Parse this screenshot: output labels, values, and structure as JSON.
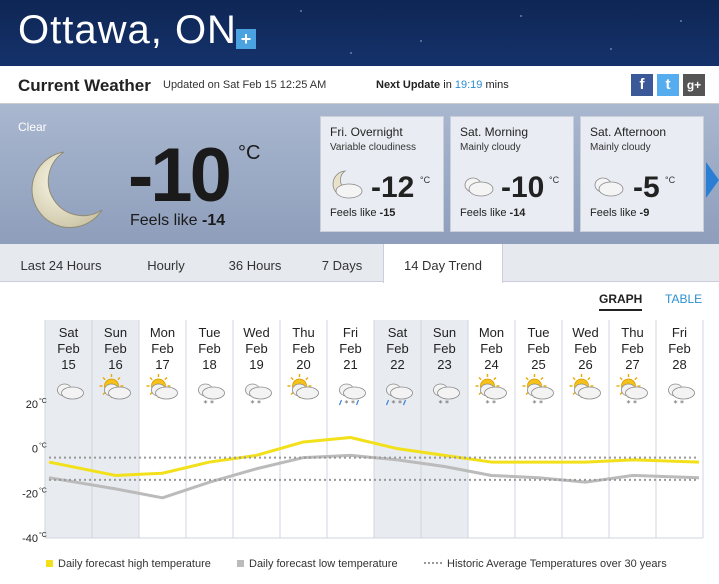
{
  "header": {
    "city": "Ottawa, ON",
    "add_label": "+"
  },
  "current_bar": {
    "title": "Current Weather",
    "updated": "Updated on Sat Feb 15 12:25 AM",
    "next_update_prefix": "Next Update",
    "next_update_in": "in",
    "next_update_time": "19:19",
    "next_update_suffix": "mins",
    "social": [
      {
        "label": "f",
        "color": "#3b5998"
      },
      {
        "label": "t",
        "color": "#55acee"
      },
      {
        "label": "g+",
        "color": "#555555"
      }
    ]
  },
  "current": {
    "condition": "Clear",
    "temp": "-10",
    "unit": "°C",
    "feels_label": "Feels like",
    "feels_value": "-14"
  },
  "forecasts": [
    {
      "period": "Fri. Overnight",
      "desc": "Variable cloudiness",
      "temp": "-12",
      "unit": "°C",
      "feels_label": "Feels like",
      "feels": "-15",
      "icon": "moon-cloud-icon"
    },
    {
      "period": "Sat. Morning",
      "desc": "Mainly cloudy",
      "temp": "-10",
      "unit": "°C",
      "feels_label": "Feels like",
      "feels": "-14",
      "icon": "cloud-icon"
    },
    {
      "period": "Sat. Afternoon",
      "desc": "Mainly cloudy",
      "temp": "-5",
      "unit": "°C",
      "feels_label": "Feels like",
      "feels": "-9",
      "icon": "cloud-icon"
    }
  ],
  "tabs": [
    "Last 24 Hours",
    "Hourly",
    "36 Hours",
    "7 Days",
    "14 Day Trend"
  ],
  "active_tab": "14 Day Trend",
  "view_toggle": {
    "graph": "GRAPH",
    "table": "TABLE"
  },
  "days": [
    {
      "dow": "Sat",
      "mon": "Feb",
      "day": "15",
      "icon": "cloud-icon",
      "weekend": true
    },
    {
      "dow": "Sun",
      "mon": "Feb",
      "day": "16",
      "icon": "sun-cloud-icon",
      "weekend": true
    },
    {
      "dow": "Mon",
      "mon": "Feb",
      "day": "17",
      "icon": "sun-cloud-icon",
      "weekend": false
    },
    {
      "dow": "Tue",
      "mon": "Feb",
      "day": "18",
      "icon": "snow-cloud-icon",
      "weekend": false
    },
    {
      "dow": "Wed",
      "mon": "Feb",
      "day": "19",
      "icon": "snow-cloud-icon",
      "weekend": false
    },
    {
      "dow": "Thu",
      "mon": "Feb",
      "day": "20",
      "icon": "sun-cloud-icon",
      "weekend": false
    },
    {
      "dow": "Fri",
      "mon": "Feb",
      "day": "21",
      "icon": "snow-rain-icon",
      "weekend": false
    },
    {
      "dow": "Sat",
      "mon": "Feb",
      "day": "22",
      "icon": "snow-rain-icon",
      "weekend": true
    },
    {
      "dow": "Sun",
      "mon": "Feb",
      "day": "23",
      "icon": "snow-cloud-icon",
      "weekend": true
    },
    {
      "dow": "Mon",
      "mon": "Feb",
      "day": "24",
      "icon": "sun-snow-icon",
      "weekend": false
    },
    {
      "dow": "Tue",
      "mon": "Feb",
      "day": "25",
      "icon": "sun-snow-icon",
      "weekend": false
    },
    {
      "dow": "Wed",
      "mon": "Feb",
      "day": "26",
      "icon": "sun-cloud-icon",
      "weekend": false
    },
    {
      "dow": "Thu",
      "mon": "Feb",
      "day": "27",
      "icon": "sun-snow-icon",
      "weekend": false
    },
    {
      "dow": "Fri",
      "mon": "Feb",
      "day": "28",
      "icon": "snow-cloud-icon",
      "weekend": false
    }
  ],
  "chart_data": {
    "type": "line",
    "x": [
      "Feb 15",
      "Feb 16",
      "Feb 17",
      "Feb 18",
      "Feb 19",
      "Feb 20",
      "Feb 21",
      "Feb 22",
      "Feb 23",
      "Feb 24",
      "Feb 25",
      "Feb 26",
      "Feb 27",
      "Feb 28"
    ],
    "ylim": [
      -40,
      20
    ],
    "yticks": [
      {
        "value": 20,
        "label": "20"
      },
      {
        "value": 0,
        "label": "0"
      },
      {
        "value": -20,
        "label": "-20"
      },
      {
        "value": -40,
        "label": "-40"
      }
    ],
    "tick_unit": "°C",
    "series": [
      {
        "name": "Daily forecast high temperature",
        "color": "#f2e01a",
        "values": [
          -6,
          -12,
          -11,
          -6,
          -3,
          3,
          5,
          0,
          -3,
          -6,
          -6,
          -6,
          -5,
          -6
        ]
      },
      {
        "name": "Daily forecast low temperature",
        "color": "#bbbbbb",
        "values": [
          -13,
          -18,
          -22,
          -15,
          -9,
          -4,
          -3,
          -5,
          -8,
          -12,
          -13,
          -15,
          -12,
          -13
        ]
      },
      {
        "name": "Historic Average Temperatures over 30 years",
        "color": "#999999",
        "style": "dotted",
        "values": [
          -4,
          -4,
          -4,
          -4,
          -4,
          -4,
          -4,
          -4,
          -4,
          -4,
          -4,
          -4,
          -4,
          -4
        ]
      },
      {
        "name": "Historic Average Temperatures over 30 years (low)",
        "color": "#999999",
        "style": "dotted",
        "values": [
          -14,
          -14,
          -14,
          -14,
          -14,
          -14,
          -14,
          -14,
          -14,
          -14,
          -14,
          -14,
          -14,
          -14
        ]
      }
    ],
    "grid": true
  },
  "legend": {
    "high": "Daily forecast high temperature",
    "low": "Daily forecast low temperature",
    "hist": "Historic Average Temperatures over 30 years"
  }
}
